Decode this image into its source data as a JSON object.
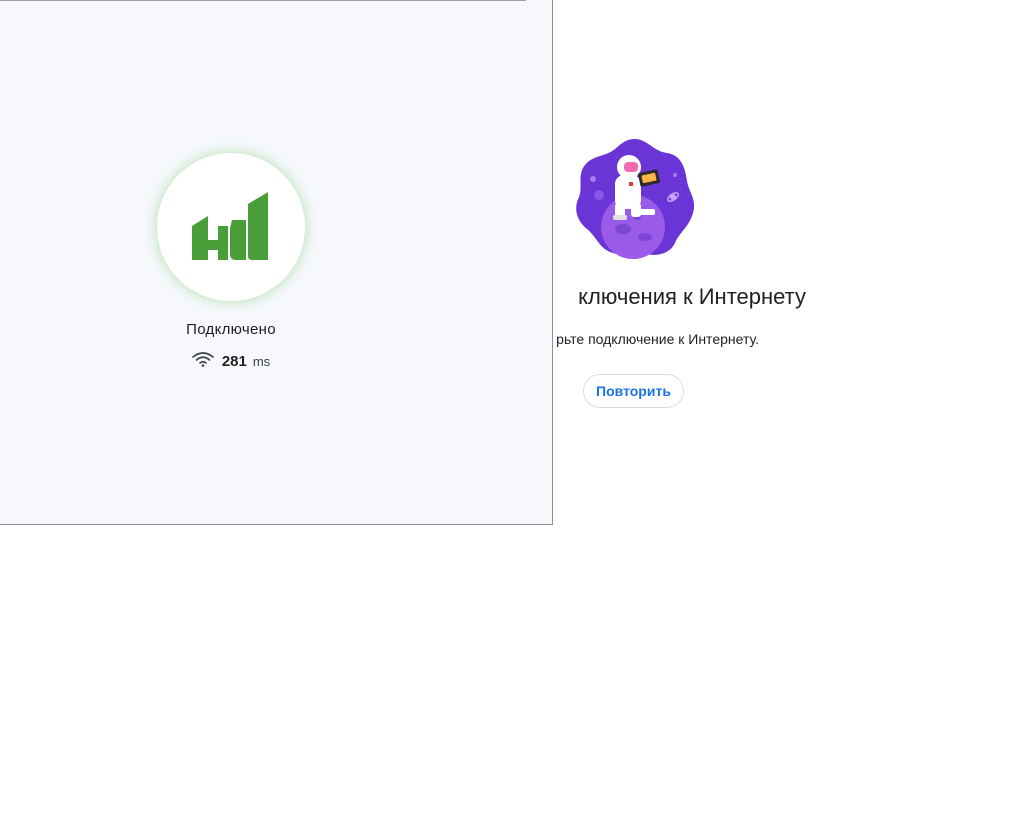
{
  "error_page": {
    "title_visible": "ключения к Интернету",
    "hint_visible": "рьте подключение к Интернету.",
    "retry_label": "Повторить"
  },
  "vpn_panel": {
    "status_label": "Подключено",
    "ping": {
      "value": "281",
      "unit": "ms"
    }
  },
  "colors": {
    "panel_background": "#f6f8fc",
    "logo_green": "#4a9e3a",
    "retry_text_blue": "#1a73e8",
    "astronaut_purple": "#6a34d6"
  },
  "icons": {
    "logo": "brand-logo-icon",
    "ping": "wifi-icon",
    "illustration": "astronaut-illustration"
  }
}
